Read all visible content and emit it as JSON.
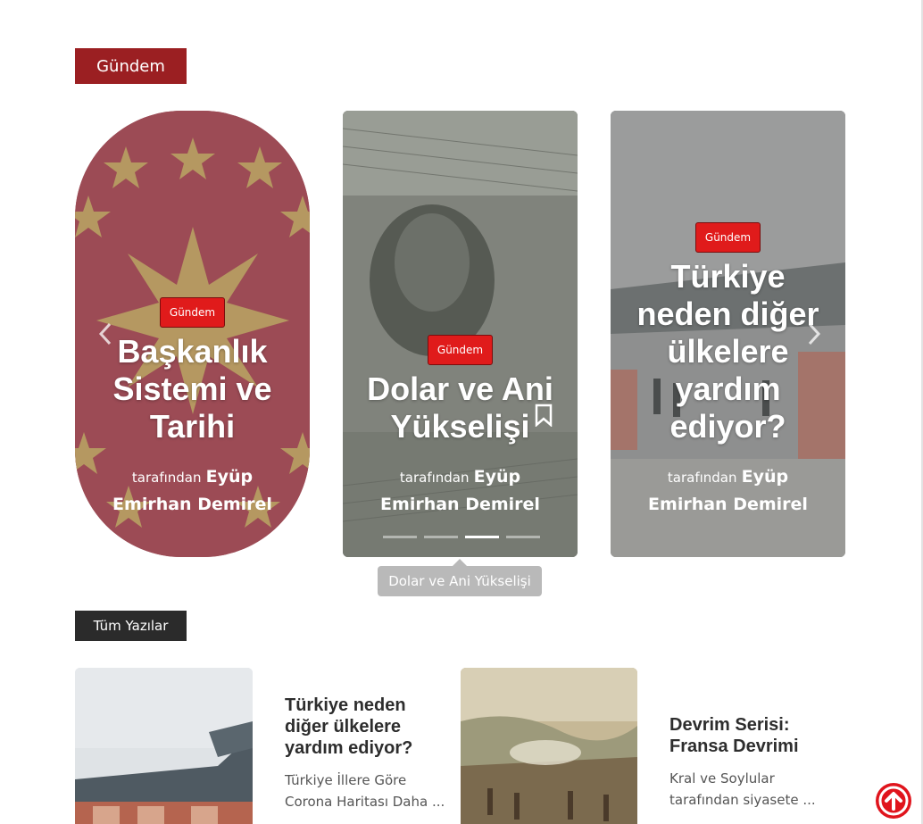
{
  "sections": {
    "featured_label": "Gündem",
    "all_posts_label": "Tüm Yazılar"
  },
  "slider": {
    "cards": [
      {
        "category": "Gündem",
        "title": "Başkanlık Sistemi ve Tarihi",
        "by": "tarafından",
        "author": "Eyüp Emirhan Demirel"
      },
      {
        "category": "Gündem",
        "title": "Dolar ve Ani Yükselişi",
        "by": "tarafından",
        "author": "Eyüp Emirhan Demirel"
      },
      {
        "category": "Gündem",
        "title": "Türkiye neden diğer ülkelere yardım ediyor?",
        "by": "tarafından",
        "author": "Eyüp Emirhan Demirel"
      }
    ],
    "tooltip": "Dolar ve Ani Yükselişi",
    "dots_count": 4,
    "active_dot": 3
  },
  "posts": [
    {
      "title": "Türkiye neden diğer ülkelere yardım ediyor?",
      "excerpt": "Türkiye İllere Göre Corona Haritası Daha ..."
    },
    {
      "title": "Devrim Serisi: Fransa Devrimi",
      "excerpt": "Kral ve Soylular tarafından siyasete ..."
    }
  ],
  "colors": {
    "featured_label_bg": "#9b1f22",
    "all_posts_label_bg": "#2b2b2b",
    "badge_bg": "#e01b1b",
    "scroll_top": "#e0141c"
  },
  "icons": {
    "prev": "chevron-left-icon",
    "next": "chevron-right-icon",
    "bookmark": "bookmark-icon",
    "scroll_top": "arrow-up-circle-icon"
  }
}
